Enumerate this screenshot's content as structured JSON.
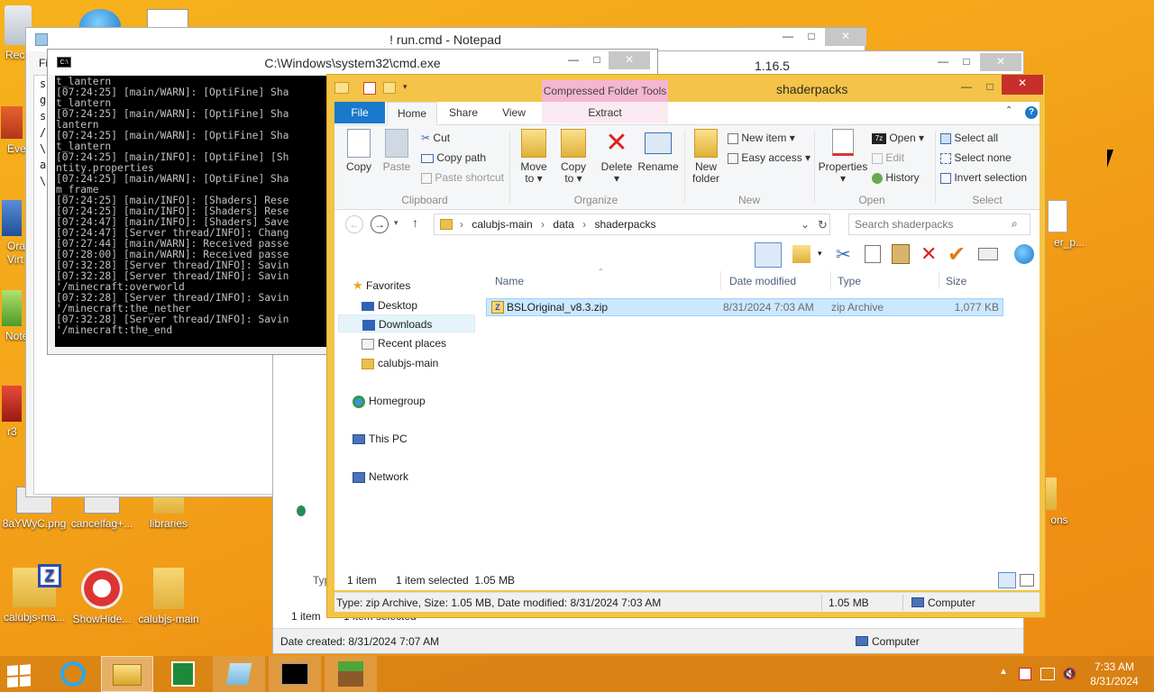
{
  "desktop": {
    "icons": [
      {
        "label": "Rec",
        "x": 0
      },
      {
        "label": "Eve"
      },
      {
        "label": "Ora\nVirt"
      },
      {
        "label": "Note"
      },
      {
        "label": "r3"
      },
      {
        "label": "8aYWyC.png"
      },
      {
        "label": "cancelfag+..."
      },
      {
        "label": "libraries"
      },
      {
        "label": "calubjs-ma..."
      },
      {
        "label": "ShowHide..."
      },
      {
        "label": "calubjs-main"
      },
      {
        "label": "er_p..."
      },
      {
        "label": "ons"
      }
    ]
  },
  "notepad": {
    "title": "! run.cmd - Notepad",
    "menu_first": "Fi",
    "left_chars": [
      "s",
      "g",
      "s",
      "/",
      "\\",
      "a",
      "\\"
    ]
  },
  "window_116": {
    "title": "1.16.5",
    "status_count": "1 item",
    "status_selected": "1 item selected",
    "date_created": "Date created: 8/31/2024 7:07 AM",
    "computer": "Computer",
    "type_trunc": "Typ"
  },
  "cmd": {
    "title": "C:\\Windows\\system32\\cmd.exe",
    "icon_label": "C:\\",
    "lines": [
      "t_lantern",
      "[07:24:25] [main/WARN]: [OptiFine] Sha",
      "t_lantern",
      "[07:24:25] [main/WARN]: [OptiFine] Sha",
      "lantern",
      "[07:24:25] [main/WARN]: [OptiFine] Sha",
      "t_lantern",
      "[07:24:25] [main/INFO]: [OptiFine] [Sh",
      "ntity.properties",
      "[07:24:25] [main/WARN]: [OptiFine] Sha",
      "m_frame",
      "[07:24:25] [main/INFO]: [Shaders] Rese",
      "[07:24:25] [main/INFO]: [Shaders] Rese",
      "[07:24:47] [main/INFO]: [Shaders] Save",
      "[07:24:47] [Server thread/INFO]: Chang",
      "[07:27:44] [main/WARN]: Received passe",
      "[07:28:00] [main/WARN]: Received passe",
      "[07:32:28] [Server thread/INFO]: Savin",
      "[07:32:28] [Server thread/INFO]: Savin",
      "'/minecraft:overworld",
      "[07:32:28] [Server thread/INFO]: Savin",
      "'/minecraft:the_nether",
      "[07:32:28] [Server thread/INFO]: Savin",
      "'/minecraft:the_end"
    ]
  },
  "explorer": {
    "title": "shaderpacks",
    "contextual_tab": "Compressed Folder Tools",
    "tabs": {
      "file": "File",
      "home": "Home",
      "share": "Share",
      "view": "View",
      "extract": "Extract"
    },
    "clipboard": {
      "copy": "Copy",
      "paste": "Paste",
      "cut": "Cut",
      "copy_path": "Copy path",
      "paste_shortcut": "Paste shortcut",
      "label": "Clipboard"
    },
    "organize": {
      "move_to": "Move\nto ▾",
      "copy_to": "Copy\nto ▾",
      "delete": "Delete\n▾",
      "rename": "Rename",
      "label": "Organize"
    },
    "new": {
      "new_folder": "New\nfolder",
      "new_item": "New item ▾",
      "easy_access": "Easy access ▾",
      "label": "New"
    },
    "open": {
      "properties": "Properties\n▾",
      "open": "Open ▾",
      "edit": "Edit",
      "history": "History",
      "label": "Open"
    },
    "select": {
      "select_all": "Select all",
      "select_none": "Select none",
      "invert": "Invert selection",
      "label": "Select"
    },
    "breadcrumb": [
      "calubjs-main",
      "data",
      "shaderpacks"
    ],
    "search_placeholder": "Search shaderpacks",
    "nav": {
      "favorites": "Favorites",
      "desktop": "Desktop",
      "downloads": "Downloads",
      "recent": "Recent places",
      "calubjs": "calubjs-main",
      "homegroup": "Homegroup",
      "thispc": "This PC",
      "network": "Network"
    },
    "columns": {
      "name": "Name",
      "date": "Date modified",
      "type": "Type",
      "size": "Size"
    },
    "files": [
      {
        "name": "BSLOriginal_v8.3.zip",
        "date": "8/31/2024 7:03 AM",
        "type": "zip Archive",
        "size": "1,077 KB"
      }
    ],
    "status_count": "1 item",
    "status_selected": "1 item selected  1.05 MB",
    "details_bar": "Type: zip Archive, Size: 1.05 MB, Date modified: 8/31/2024 7:03 AM",
    "details_size": "1.05 MB",
    "details_computer": "Computer"
  },
  "taskbar": {
    "time": "7:33 AM",
    "date": "8/31/2024"
  },
  "colors": {
    "explorer_frame": "#f3c447",
    "selection": "#cce8ff",
    "close_red": "#c7302a",
    "contextual_tab": "#f5b6d2"
  }
}
